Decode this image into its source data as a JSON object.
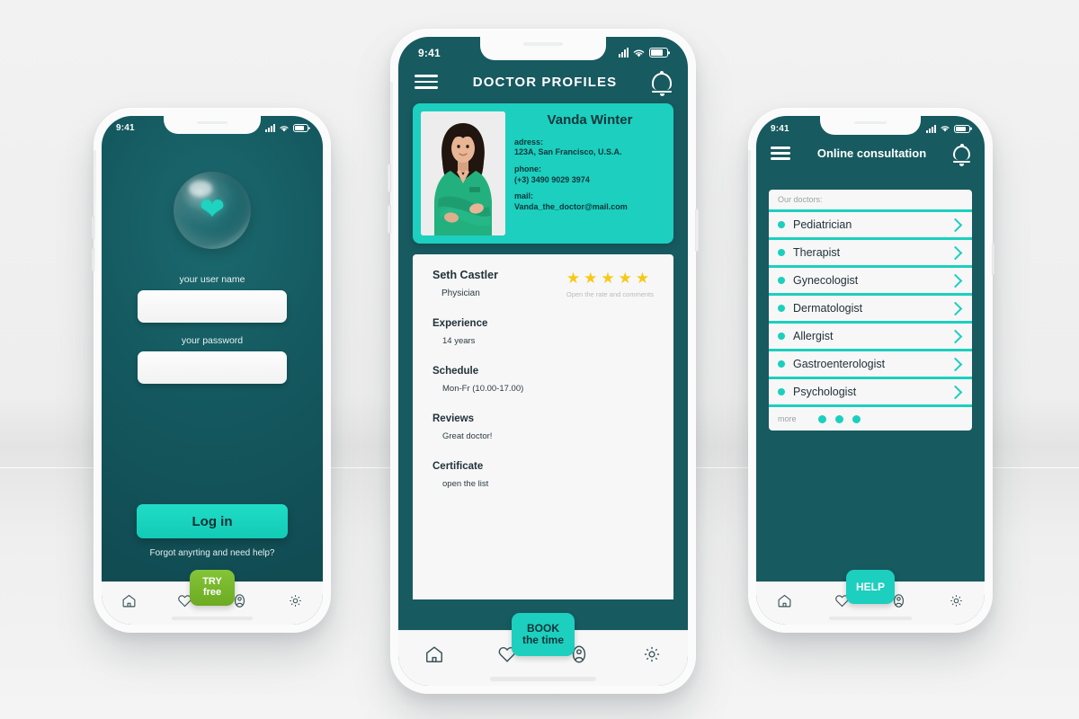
{
  "phone_login": {
    "status_bar": {
      "time": "9:41",
      "signal_icon": "signal-bars-icon",
      "wifi_icon": "wifi-icon",
      "battery_icon": "battery-icon"
    },
    "logo_icon": "heart-bubble-logo",
    "username_label": "your user name",
    "username_value": "",
    "password_label": "your password",
    "password_value": "",
    "login_button": "Log in",
    "forgot_link": "Forgot anyrting and need help?",
    "fab": {
      "line1": "TRY",
      "line2": "free",
      "color": "#76b82a"
    },
    "nav": [
      {
        "icon": "home-icon"
      },
      {
        "icon": "heart-icon"
      },
      {
        "icon": "profile-icon"
      },
      {
        "icon": "gear-icon"
      }
    ]
  },
  "phone_profile": {
    "status_bar": {
      "time": "9:41"
    },
    "appbar": {
      "menu_icon": "hamburger-menu-icon",
      "title": "DOCTOR PROFILES",
      "bell_icon": "bell-icon"
    },
    "card": {
      "photo_alt": "doctor-portrait",
      "name": "Vanda Winter",
      "address_label": "adress:",
      "address_value": "123A, San Francisco, U.S.A.",
      "phone_label": "phone:",
      "phone_value": "(+3) 3490 9029 3974",
      "mail_label": "mail:",
      "mail_value": "Vanda_the_doctor@mail.com",
      "bg_color": "#1ccfbe"
    },
    "rating": {
      "doctor_name": "Seth Castler",
      "role": "Physician",
      "stars": 5,
      "star_color": "#f6c914",
      "cta": "Open the rate and comments"
    },
    "details": [
      {
        "label": "Experience",
        "value": "14 years"
      },
      {
        "label": "Schedule",
        "value": "Mon-Fr (10.00-17.00)"
      },
      {
        "label": "Reviews",
        "value": "Great doctor!"
      },
      {
        "label": "Certificate",
        "value": "open the list"
      }
    ],
    "fab": {
      "line1": "BOOK",
      "line2": "the time",
      "color": "#1ccfbe"
    },
    "nav": [
      {
        "icon": "home-icon"
      },
      {
        "icon": "heart-icon"
      },
      {
        "icon": "profile-icon"
      },
      {
        "icon": "gear-icon"
      }
    ]
  },
  "phone_consultation": {
    "status_bar": {
      "time": "9:41"
    },
    "appbar": {
      "menu_icon": "hamburger-menu-icon",
      "title": "Online consultation",
      "bell_icon": "bell-icon"
    },
    "search_placeholder": "Our doctors:",
    "specialties": [
      {
        "name": "Pediatrician"
      },
      {
        "name": "Therapist"
      },
      {
        "name": "Gynecologist"
      },
      {
        "name": "Dermatologist"
      },
      {
        "name": "Allergist"
      },
      {
        "name": "Gastroenterologist"
      },
      {
        "name": "Psychologist"
      }
    ],
    "more_label": "more",
    "pagination_dots": 3,
    "fab": {
      "line1": "HELP",
      "line2": "",
      "color": "#1ccfbe"
    },
    "nav": [
      {
        "icon": "home-icon"
      },
      {
        "icon": "heart-icon"
      },
      {
        "icon": "profile-icon"
      },
      {
        "icon": "gear-icon"
      }
    ]
  },
  "theme": {
    "dark_teal": "#175a60",
    "accent_teal": "#1ccfbe",
    "green": "#76b82a",
    "star_yellow": "#f6c914",
    "sheet_white": "#f7f7f7"
  }
}
